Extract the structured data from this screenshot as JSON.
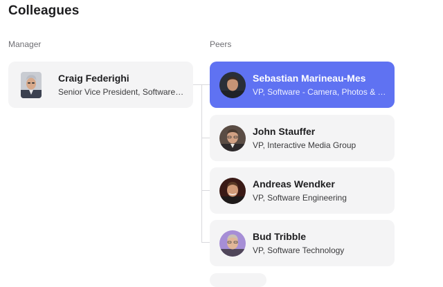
{
  "page": {
    "title": "Colleagues"
  },
  "sections": {
    "manager_label": "Manager",
    "peers_label": "Peers"
  },
  "manager": {
    "name": "Craig Federighi",
    "role": "Senior Vice President, Software Engineering"
  },
  "peers": [
    {
      "name": "Sebastian Marineau-Mes",
      "role": "VP, Software - Camera, Photos & Media",
      "selected": true
    },
    {
      "name": "John Stauffer",
      "role": "VP, Interactive Media Group",
      "selected": false
    },
    {
      "name": "Andreas Wendker",
      "role": "VP, Software Engineering",
      "selected": false
    },
    {
      "name": "Bud Tribble",
      "role": "VP, Software Technology",
      "selected": false
    }
  ],
  "colors": {
    "selected_card": "#5f72f2",
    "card_background": "#f4f4f5",
    "connector": "#d8d8dc",
    "secondary_text": "#6e6e73"
  }
}
